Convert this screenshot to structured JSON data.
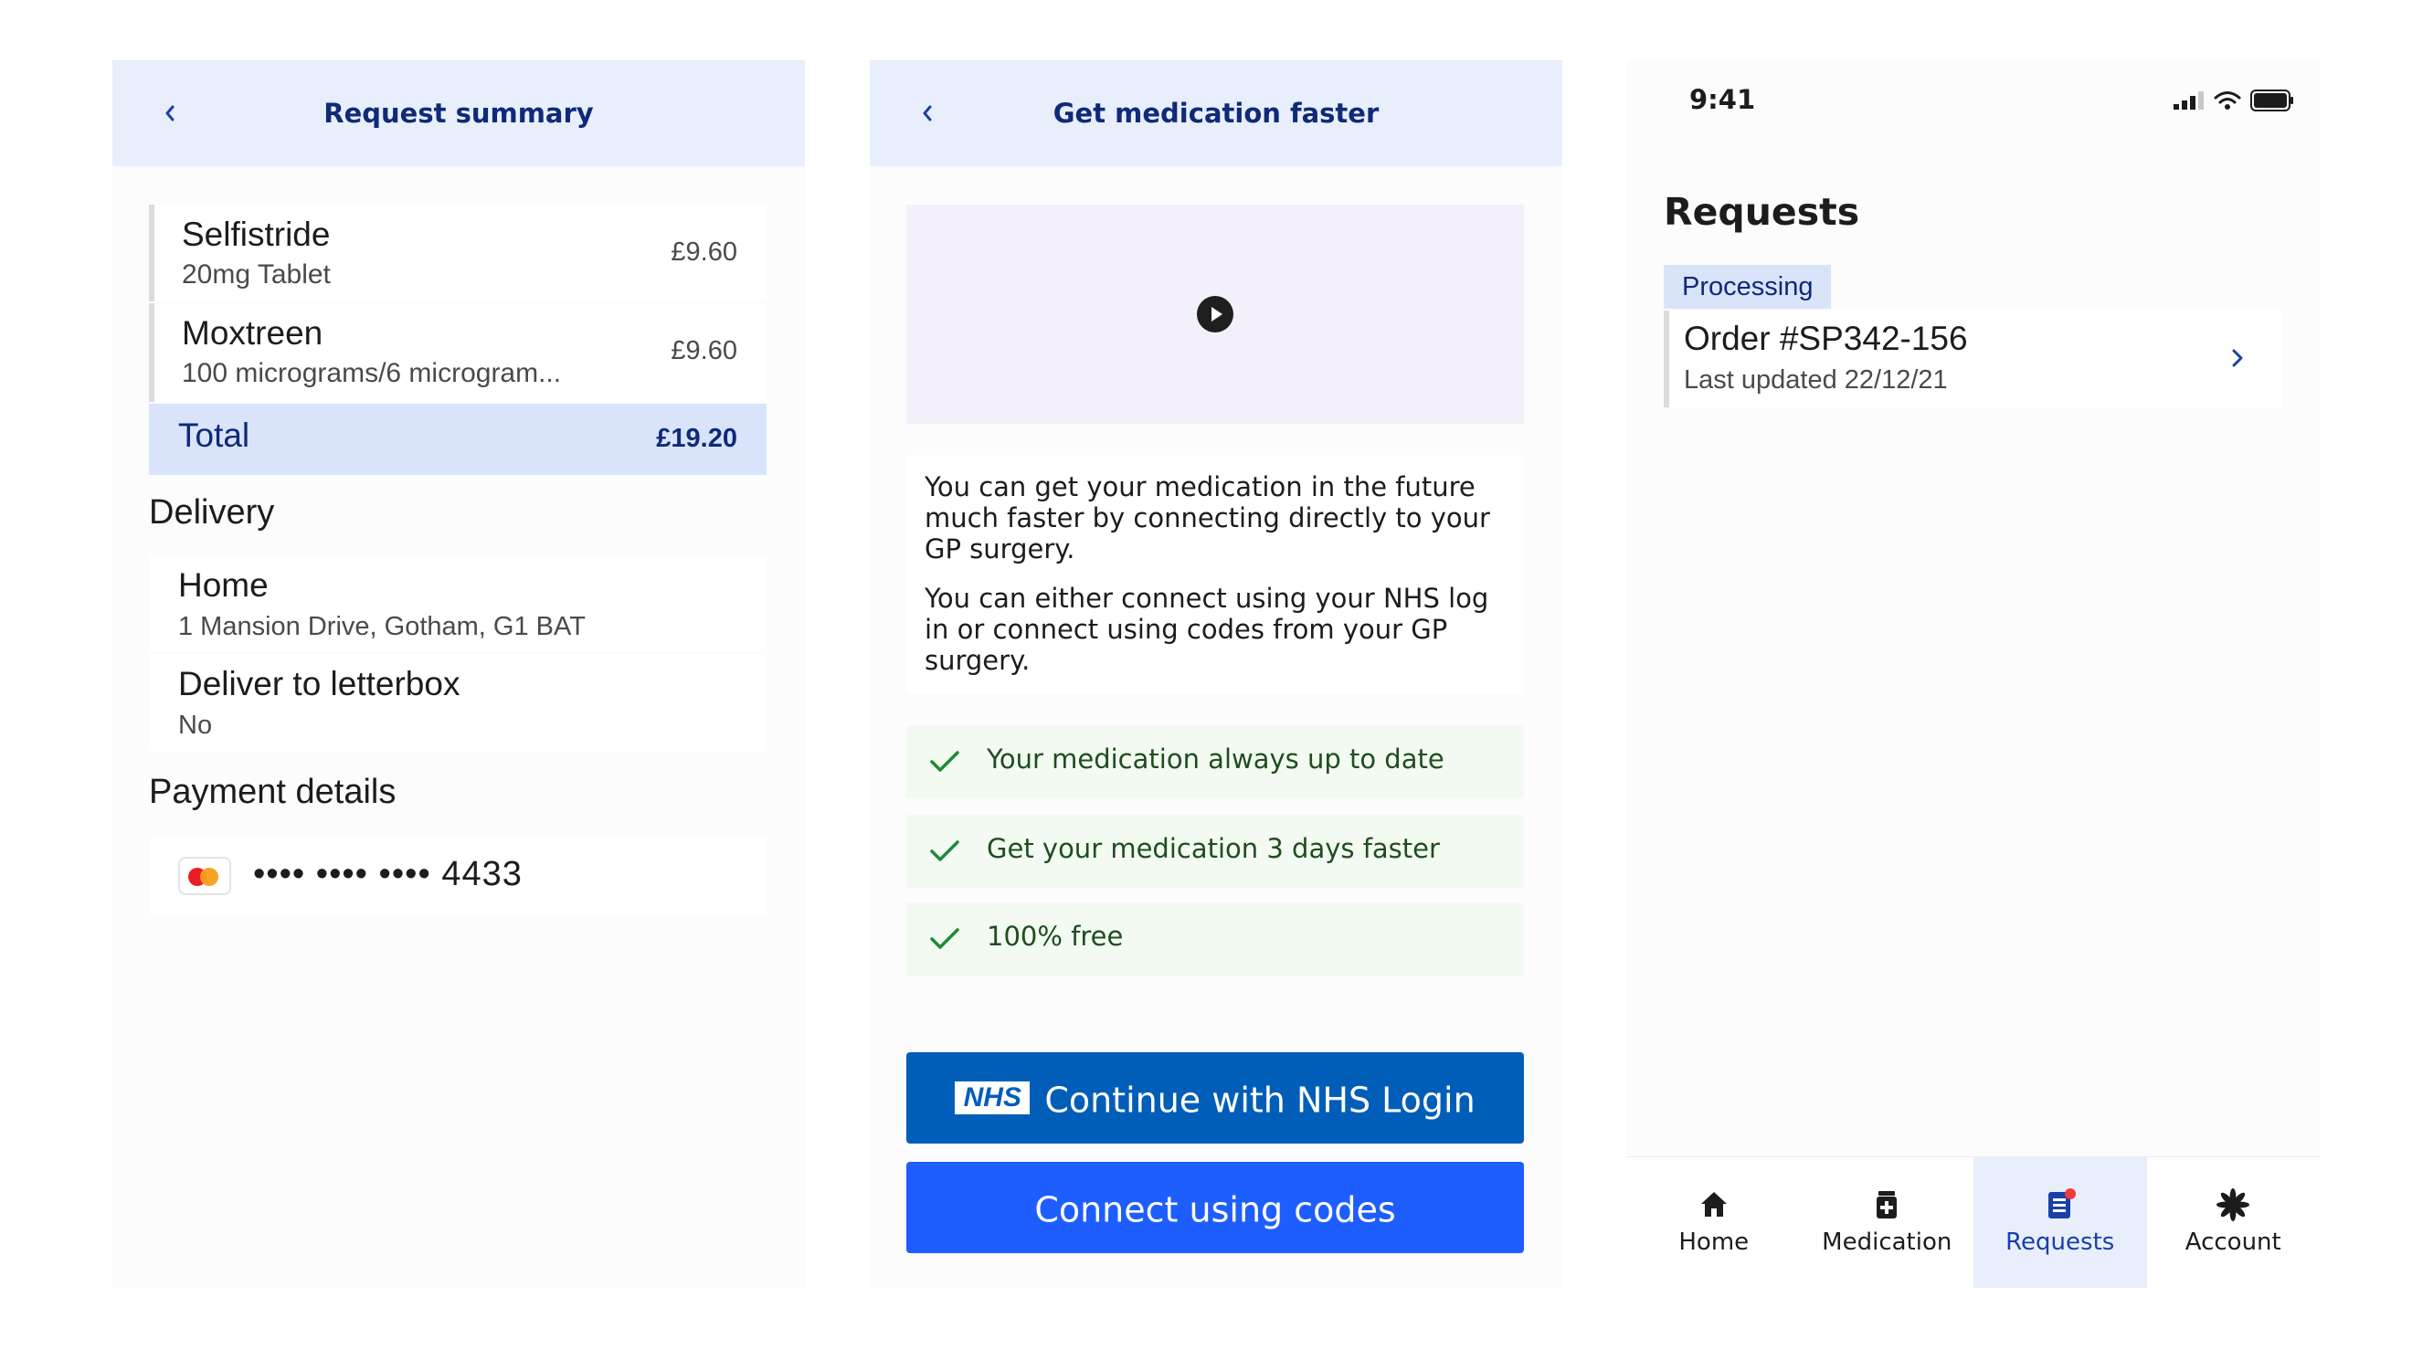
{
  "summary": {
    "title": "Request summary",
    "items": [
      {
        "name": "Selfistride",
        "detail": "20mg Tablet",
        "price": "£9.60"
      },
      {
        "name": "Moxtreen",
        "detail": "100 micrograms/6 microgram...",
        "price": "£9.60"
      }
    ],
    "total_label": "Total",
    "total_amount": "£19.20",
    "delivery_heading": "Delivery",
    "delivery": [
      {
        "name": "Home",
        "detail": "1 Mansion Drive, Gotham, G1 BAT"
      },
      {
        "name": "Deliver to letterbox",
        "detail": "No"
      }
    ],
    "payment_heading": "Payment details",
    "card_number": "•••• •••• •••• 4433",
    "card_icon": "mastercard-icon"
  },
  "faster": {
    "title": "Get medication faster",
    "paragraph1": "You can get your medication in the future much faster by connecting directly to your GP surgery.",
    "paragraph2": "You can either connect using your NHS log in or connect using codes from your GP surgery.",
    "benefits": [
      "Your medication always up to date",
      "Get your medication 3 days faster",
      "100% free"
    ],
    "nhs_logo_text": "NHS",
    "nhs_button": "Continue with NHS Login",
    "codes_button": "Connect using codes",
    "colors": {
      "nhs_blue": "#005eb8",
      "primary_blue": "#1e5eff",
      "benefit_bg": "#f3faf2",
      "check_green": "#1e8a35"
    }
  },
  "requests": {
    "status_time": "9:41",
    "title": "Requests",
    "badge": "Processing",
    "order_title": "Order #SP342-156",
    "order_updated": "Last updated 22/12/21",
    "tabs": [
      {
        "label": "Home",
        "icon": "home-icon"
      },
      {
        "label": "Medication",
        "icon": "medication-icon"
      },
      {
        "label": "Requests",
        "icon": "requests-icon",
        "active": true
      },
      {
        "label": "Account",
        "icon": "account-icon"
      }
    ]
  }
}
